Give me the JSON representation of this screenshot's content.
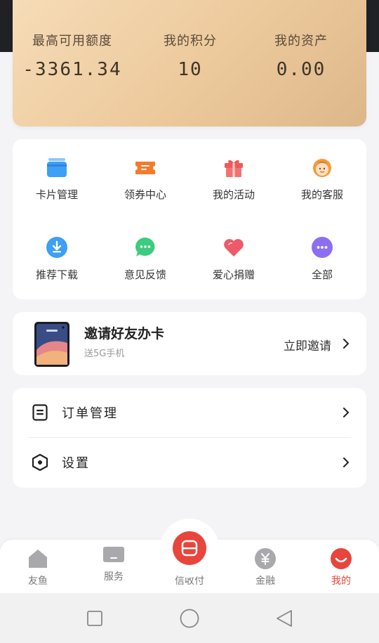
{
  "stats": [
    {
      "label": "最高可用额度",
      "value": "-3361.34"
    },
    {
      "label": "我的积分",
      "value": "10"
    },
    {
      "label": "我的资产",
      "value": "0.00"
    }
  ],
  "grid": [
    {
      "label": "卡片管理",
      "icon": "card-stack-icon",
      "color": "#3d9ff5"
    },
    {
      "label": "领券中心",
      "icon": "coupon-icon",
      "color": "#f47a2c"
    },
    {
      "label": "我的活动",
      "icon": "gift-icon",
      "color": "#ee5a5a"
    },
    {
      "label": "我的客服",
      "icon": "customer-service-icon",
      "color": "#f39a3c"
    },
    {
      "label": "推荐下载",
      "icon": "download-icon",
      "color": "#3d9ff5"
    },
    {
      "label": "意见反馈",
      "icon": "feedback-chat-icon",
      "color": "#3ccb7f"
    },
    {
      "label": "爱心捐赠",
      "icon": "heart-icon",
      "color": "#ee5a67"
    },
    {
      "label": "全部",
      "icon": "more-dots-icon",
      "color": "#8b6ff0"
    }
  ],
  "invite": {
    "title": "邀请好友办卡",
    "subtitle": "送5G手机",
    "action": "立即邀请"
  },
  "menu": [
    {
      "label": "订单管理",
      "icon": "order-list-icon"
    },
    {
      "label": "设置",
      "icon": "settings-hexagon-icon"
    }
  ],
  "tabs": [
    {
      "label": "友鱼",
      "icon": "home-icon"
    },
    {
      "label": "服务",
      "icon": "service-card-icon"
    },
    {
      "label": "信收付",
      "icon": "scan-pay-icon"
    },
    {
      "label": "金融",
      "icon": "yuan-coin-icon"
    },
    {
      "label": "我的",
      "icon": "profile-smile-icon"
    }
  ],
  "colors": {
    "accent": "#e8453c",
    "card_gradient_start": "#f6dcb8",
    "card_gradient_end": "#dcb78a"
  }
}
